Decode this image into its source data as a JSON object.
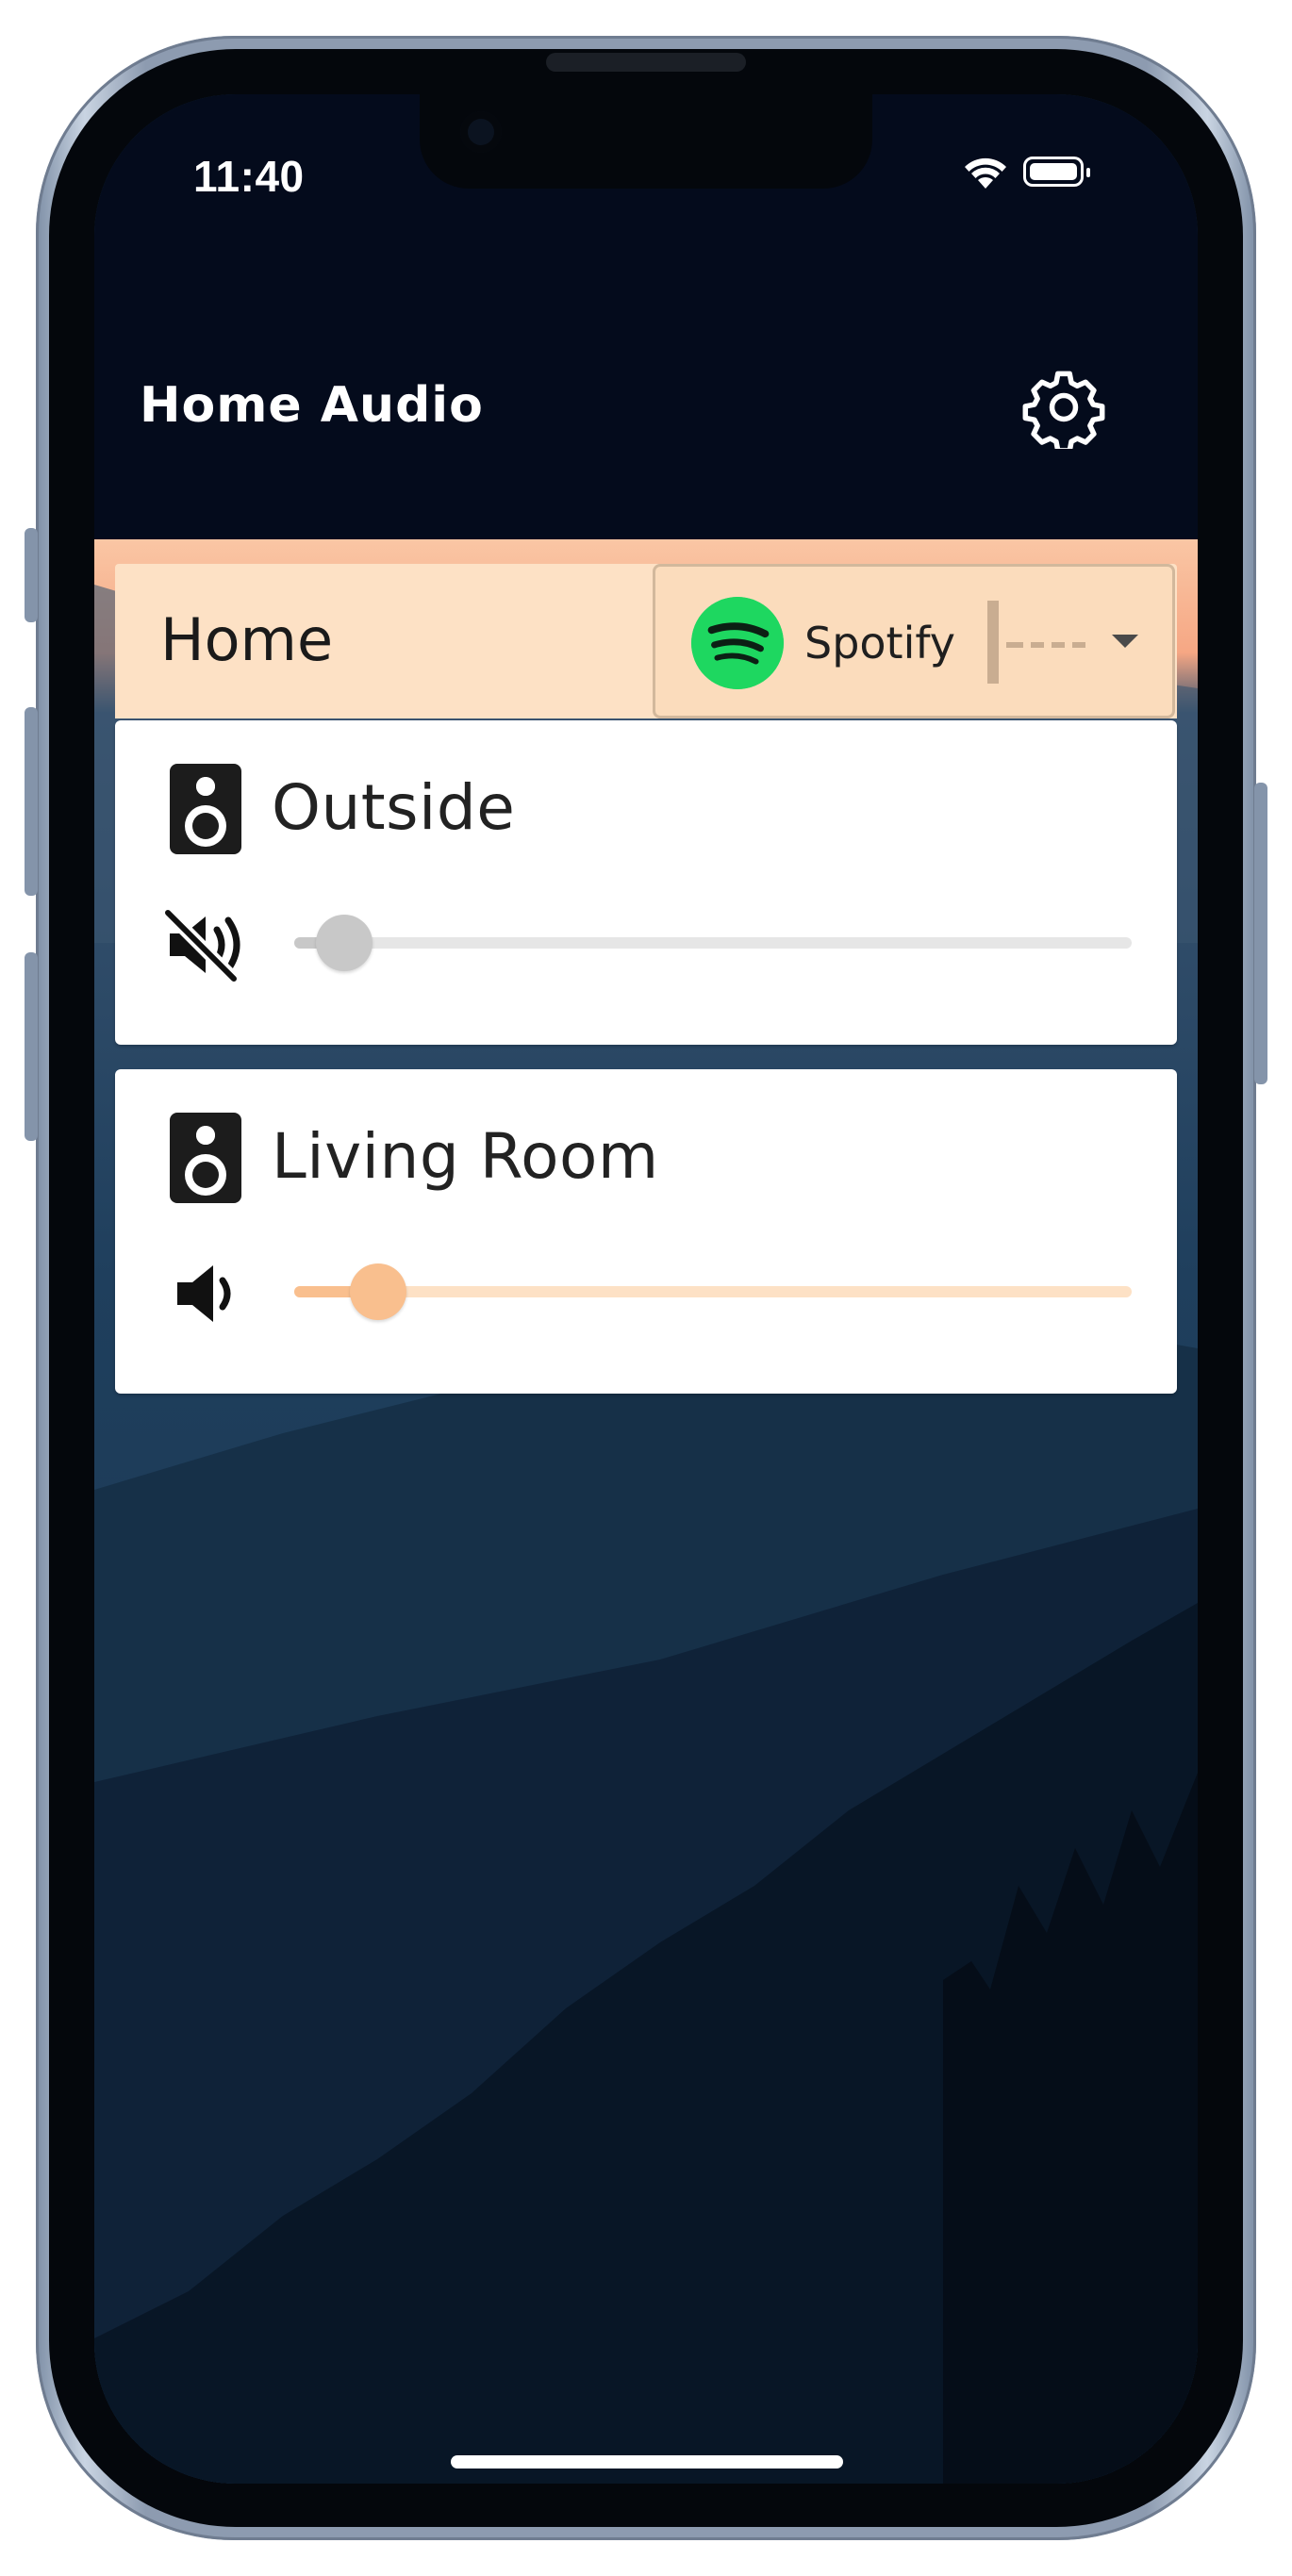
{
  "status_bar": {
    "time": "11:40"
  },
  "app_bar": {
    "title": "Home Audio",
    "settings_icon": "gear-icon"
  },
  "group": {
    "name": "Home",
    "source": {
      "label": "Spotify",
      "icon": "spotify-icon",
      "dropdown_icon": "caret-down-icon"
    }
  },
  "rooms": [
    {
      "name": "Outside",
      "icon": "speaker-icon",
      "volume_icon": "muted-speaker-icon",
      "muted": true,
      "volume": 0.06,
      "color": "#c8c8c8"
    },
    {
      "name": "Living Room",
      "icon": "speaker-icon",
      "volume_icon": "speaker-volume-icon",
      "muted": false,
      "volume": 0.1,
      "color": "#f9bf8e"
    }
  ],
  "theme": {
    "accent": "#f9bf8e",
    "app_bar_bg": "#040b1c",
    "group_bg": "#fde1c5",
    "spotify_green": "#1ed760"
  }
}
